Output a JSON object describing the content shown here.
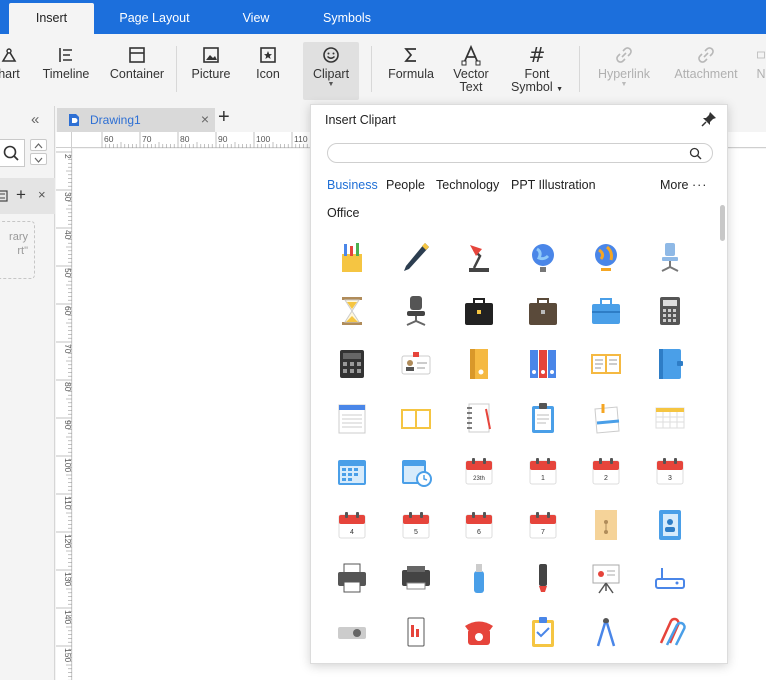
{
  "menu": {
    "tabs": [
      {
        "label": "Insert",
        "active": true
      },
      {
        "label": "Page Layout",
        "active": false
      },
      {
        "label": "View",
        "active": false
      },
      {
        "label": "Symbols",
        "active": false
      }
    ]
  },
  "ribbon": {
    "buttons": [
      {
        "label": "hart",
        "icon": "chart-icon"
      },
      {
        "label": "Timeline",
        "icon": "timeline-icon"
      },
      {
        "label": "Container",
        "icon": "container-icon"
      },
      {
        "label": "Picture",
        "icon": "picture-icon"
      },
      {
        "label": "Icon",
        "icon": "icon-icon"
      },
      {
        "label": "Clipart",
        "icon": "clipart-icon"
      },
      {
        "label": "Formula",
        "icon": "formula-icon"
      },
      {
        "label": "Vector",
        "label2": "Text",
        "icon": "vector-text-icon"
      },
      {
        "label": "Font",
        "label2": "Symbol",
        "icon": "font-symbol-icon"
      },
      {
        "label": "Hyperlink",
        "icon": "hyperlink-icon"
      },
      {
        "label": "Attachment",
        "icon": "attachment-icon"
      },
      {
        "label": "N",
        "icon": "note-icon"
      }
    ]
  },
  "left_panel": {
    "library_text_1": "rary",
    "library_text_2": "rt\""
  },
  "document": {
    "tab_name": "Drawing1"
  },
  "rulers": {
    "h_labels": [
      "60",
      "70",
      "80",
      "90",
      "100",
      "110"
    ],
    "v_labels": [
      "2",
      "30",
      "40",
      "50",
      "60",
      "70",
      "80",
      "90",
      "100",
      "110",
      "120",
      "130",
      "140",
      "150"
    ]
  },
  "clipart_popup": {
    "title": "Insert Clipart",
    "search_placeholder": "",
    "categories": [
      "Business",
      "People",
      "Technology",
      "PPT Illustration"
    ],
    "active_category": "Business",
    "more_label": "More",
    "section_label": "Office",
    "items": [
      "pencil-cup-icon",
      "pen-icon",
      "desk-lamp-icon",
      "globe-icon",
      "globe-stand-icon",
      "office-chair-blue-icon",
      "hourglass-icon",
      "office-chair-icon",
      "briefcase-black-icon",
      "briefcase-brown-icon",
      "toolbox-icon",
      "calculator-gray-icon",
      "calculator-dark-icon",
      "id-card-icon",
      "binder-yellow-icon",
      "binders-icon",
      "open-book-icon",
      "notebook-blue-icon",
      "notepad-icon",
      "book-icon",
      "spiral-notebook-icon",
      "clipboard-icon",
      "paper-clip-note-icon",
      "spreadsheet-icon",
      "calendar-grid-icon",
      "calendar-clock-icon",
      "calendar-23-icon",
      "calendar-1-icon",
      "calendar-2-icon",
      "calendar-3-icon",
      "calendar-4-icon",
      "calendar-5-icon",
      "calendar-6-icon",
      "calendar-7-icon",
      "envelope-folder-icon",
      "address-book-icon",
      "printer-icon",
      "printer-dark-icon",
      "usb-drive-icon",
      "marker-icon",
      "presentation-board-icon",
      "router-icon",
      "projector-icon",
      "phone-device-icon",
      "telephone-red-icon",
      "clipboard-check-icon",
      "compass-tool-icon",
      "paper-clips-icon"
    ],
    "calendar_numbers": {
      "c23": "23th",
      "c1": "1",
      "c2": "2",
      "c3": "3",
      "c4": "4",
      "c5": "5",
      "c6": "6",
      "c7": "7"
    }
  },
  "colors": {
    "menu_bar": "#1c6fdc",
    "accent": "#1f6fd6"
  }
}
